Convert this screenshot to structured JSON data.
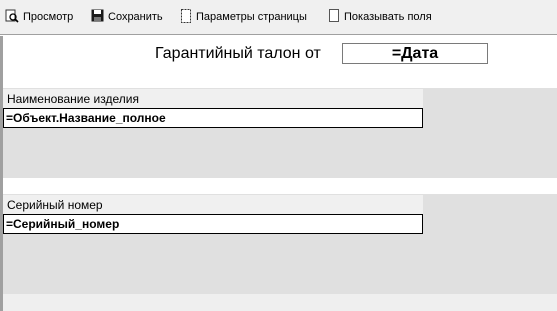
{
  "toolbar": {
    "items": [
      {
        "label": "Просмотр",
        "icon": "preview-icon"
      },
      {
        "label": "Сохранить",
        "icon": "save-icon"
      },
      {
        "label": "Параметры страницы",
        "icon": "page-settings-icon"
      },
      {
        "label": "Показывать поля",
        "icon": "show-fields-checkbox"
      }
    ]
  },
  "header": {
    "title": "Гарантийный талон от",
    "date_field": "=Дата"
  },
  "sections": [
    {
      "caption": "Наименование изделия",
      "value": "=Объект.Название_полное"
    },
    {
      "caption": "Серийный номер",
      "value": "=Серийный_номер"
    }
  ],
  "colors": {
    "band_gray": "#e0e0e0",
    "band_white": "#ffffff",
    "field_border": "#000000"
  }
}
